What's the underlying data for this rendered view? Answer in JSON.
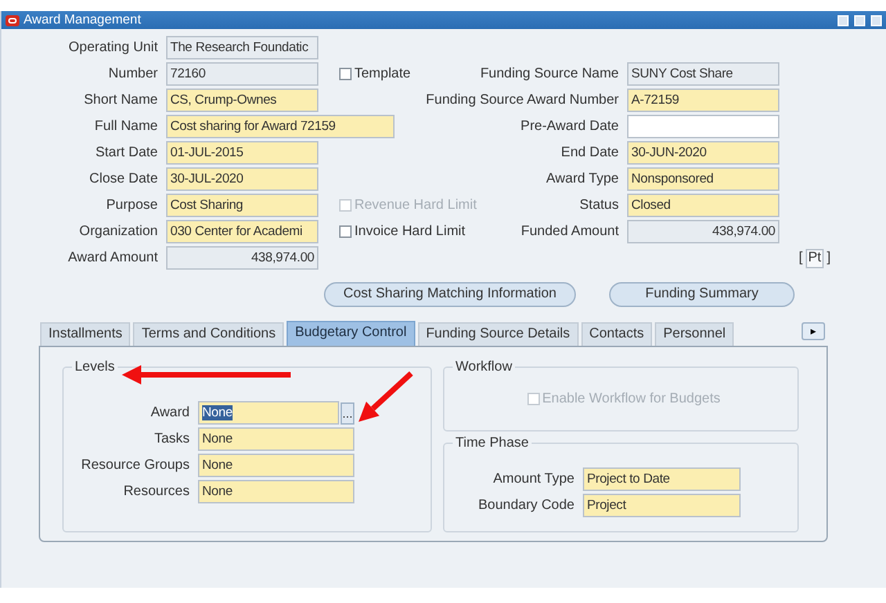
{
  "window": {
    "title": "Award Management"
  },
  "header_rows": [
    {
      "left": {
        "label": "Operating Unit",
        "value": "The Research Foundatic",
        "kind": "readonly"
      }
    },
    {
      "left": {
        "label": "Number",
        "value": "72160",
        "kind": "readonly"
      },
      "checkbox": {
        "label": "Template",
        "checked": false,
        "disabled": false
      },
      "right": {
        "label": "Funding Source Name",
        "value": "SUNY Cost Share",
        "kind": "readonly"
      }
    },
    {
      "left": {
        "label": "Short Name",
        "value": "CS, Crump-Ownes",
        "kind": "required"
      },
      "right": {
        "label": "Funding Source Award Number",
        "value": "A-72159",
        "kind": "required"
      }
    },
    {
      "left": {
        "label": "Full Name",
        "value": "Cost sharing for Award 72159",
        "kind": "required"
      },
      "right": {
        "label": "Pre-Award Date",
        "kind": "optional"
      }
    },
    {
      "left": {
        "label": "Start Date",
        "value": "01-JUL-2015",
        "kind": "required"
      },
      "right": {
        "label": "End Date",
        "value": "30-JUN-2020",
        "kind": "required"
      }
    },
    {
      "left": {
        "label": "Close Date",
        "value": "30-JUL-2020",
        "kind": "required"
      },
      "right": {
        "label": "Award Type",
        "value": "Nonsponsored",
        "kind": "required"
      }
    },
    {
      "left": {
        "label": "Purpose",
        "value": "Cost Sharing",
        "kind": "required"
      },
      "checkbox": {
        "label": "Revenue Hard Limit",
        "checked": false,
        "disabled": true
      },
      "right": {
        "label": "Status",
        "value": "Closed",
        "kind": "required"
      }
    },
    {
      "left": {
        "label": "Organization",
        "value": "030 Center for Academi",
        "kind": "required"
      },
      "checkbox": {
        "label": "Invoice Hard Limit",
        "checked": false,
        "disabled": false
      },
      "right": {
        "label": "Funded Amount",
        "value": "438,974.00",
        "kind": "amount"
      }
    },
    {
      "left": {
        "label": "Award Amount",
        "value": "438,974.00",
        "kind": "amount"
      },
      "marker": {
        "open": "[",
        "label": "Pt",
        "close": "]"
      }
    }
  ],
  "buttons": [
    "Cost Sharing Matching Information",
    "Funding Summary"
  ],
  "tabs": [
    {
      "label": "Installments",
      "selected": false
    },
    {
      "label": "Terms and Conditions",
      "selected": false
    },
    {
      "label": "Budgetary Control",
      "selected": true
    },
    {
      "label": "Funding Source Details",
      "selected": false
    },
    {
      "label": "Contacts",
      "selected": false
    },
    {
      "label": "Personnel",
      "selected": false
    }
  ],
  "tab_scroll": "▸",
  "levels": {
    "title": "Levels",
    "fields": [
      {
        "label": "Award",
        "value": "None",
        "kind": "required",
        "text_selected": true,
        "lov_button": "..."
      },
      {
        "label": "Tasks",
        "value": "None",
        "kind": "required",
        "text_selected": false
      },
      {
        "label": "Resource Groups",
        "value": "None",
        "kind": "required",
        "text_selected": false
      },
      {
        "label": "Resources",
        "value": "None",
        "kind": "required",
        "text_selected": false
      }
    ]
  },
  "workflow": {
    "title": "Workflow",
    "checkbox": {
      "label": "Enable Workflow for Budgets",
      "checked": false,
      "disabled": true
    }
  },
  "time_phase": {
    "title": "Time Phase",
    "fields": [
      {
        "label": "Amount Type",
        "value": "Project to Date",
        "kind": "required"
      },
      {
        "label": "Boundary Code",
        "value": "Project",
        "kind": "required"
      }
    ]
  },
  "annotations": [
    {
      "kind": "arrow"
    },
    {
      "kind": "arrow"
    }
  ]
}
